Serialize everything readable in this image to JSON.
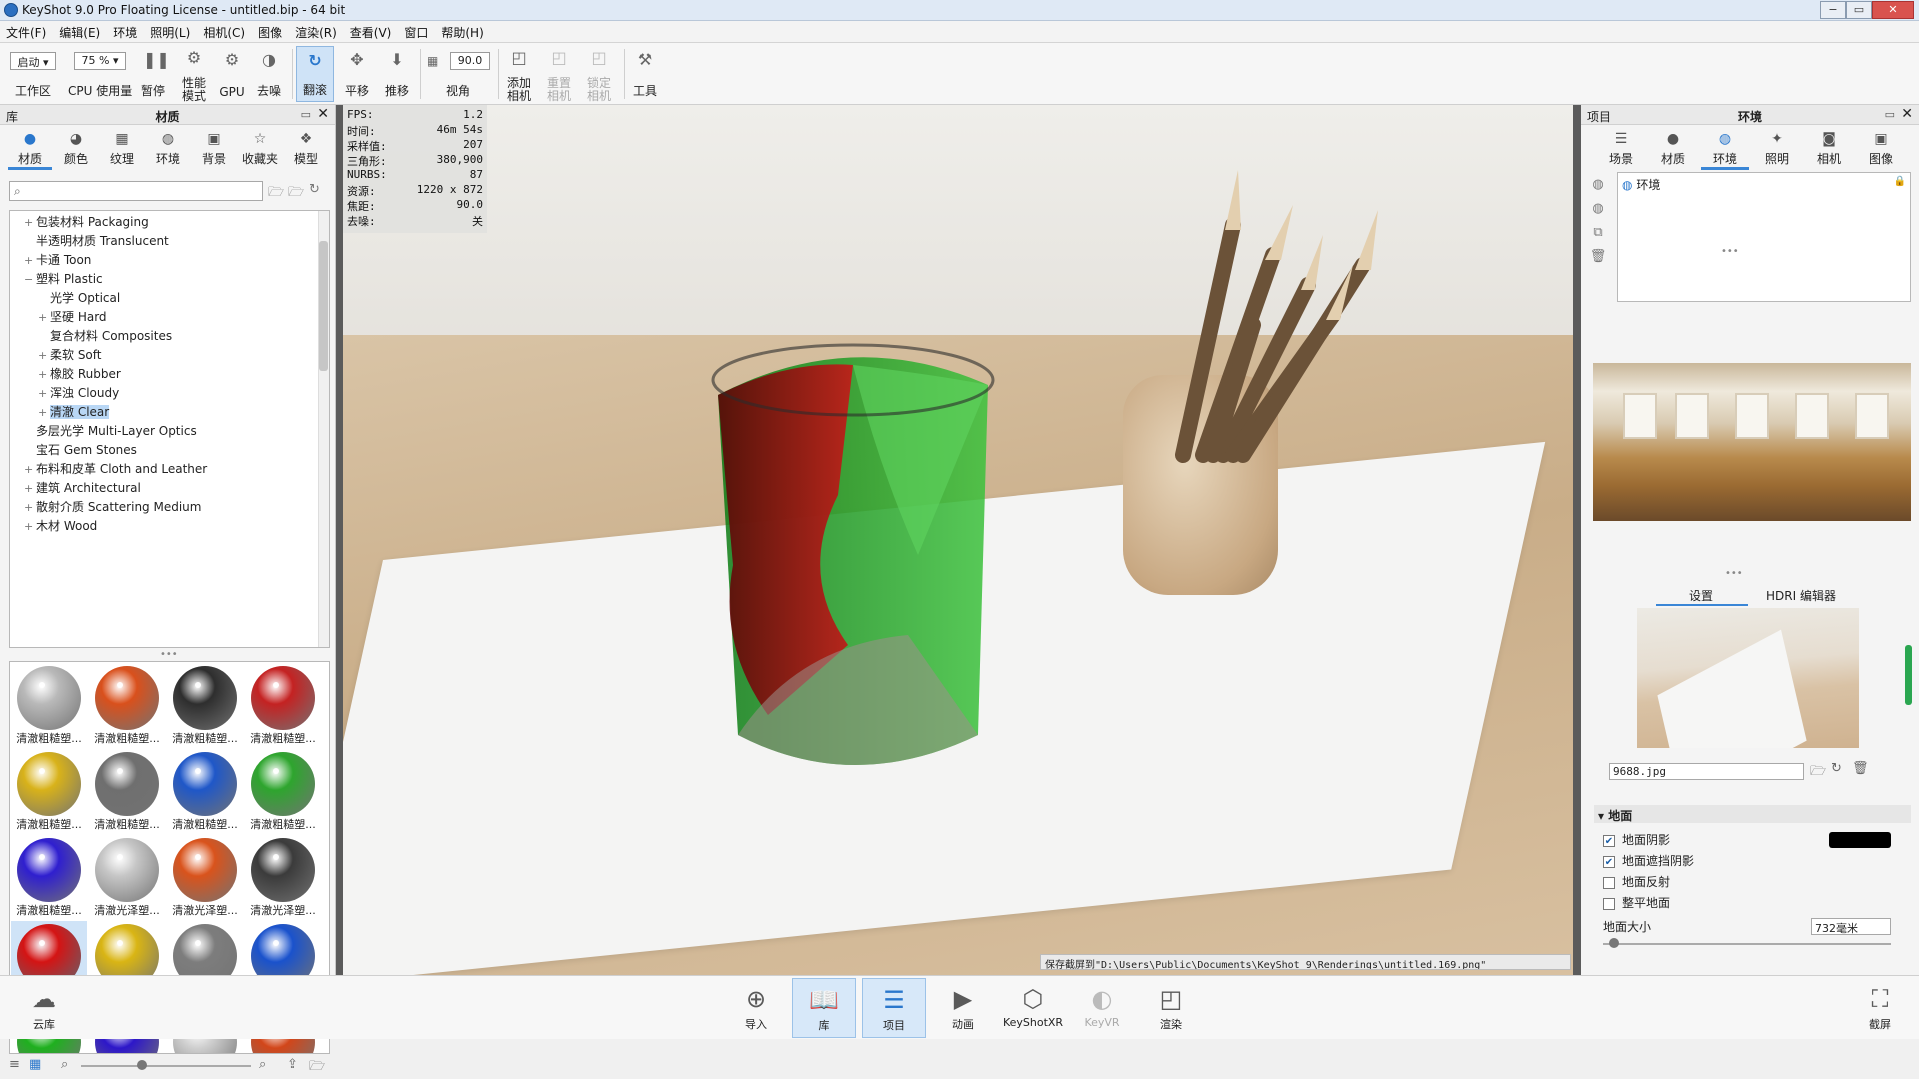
{
  "window": {
    "title": "KeyShot 9.0 Pro Floating License  - untitled.bip  - 64 bit"
  },
  "menu": [
    "文件(F)",
    "编辑(E)",
    "环境",
    "照明(L)",
    "相机(C)",
    "图像",
    "渲染(R)",
    "查看(V)",
    "窗口",
    "帮助(H)"
  ],
  "toolbar": {
    "workspace_value": "启动",
    "workspace_label": "工作区",
    "cpu_value": "75 %",
    "cpu_label": "CPU 使用量",
    "pause_label": "暂停",
    "perf_label": "性能\n模式",
    "gpu_label": "GPU",
    "denoise_label": "去噪",
    "tumble_label": "翻滚",
    "pan_label": "平移",
    "dolly_label": "推移",
    "fov_value": "90.0",
    "fov_label": "视角",
    "add_camera_label": "添加\n相机",
    "reset_camera_label": "重置\n相机",
    "lock_camera_label": "锁定\n相机",
    "tools_label": "工具"
  },
  "library": {
    "header_left": "库",
    "header_title": "材质",
    "tabs": [
      "材质",
      "颜色",
      "纹理",
      "环境",
      "背景",
      "收藏夹",
      "模型"
    ],
    "selected_tab": "材质",
    "search_placeholder": "",
    "tree": [
      {
        "label": "包装材料 Packaging",
        "level": 0,
        "exp": "+"
      },
      {
        "label": "半透明材质 Translucent",
        "level": 0,
        "exp": ""
      },
      {
        "label": "卡通 Toon",
        "level": 0,
        "exp": "+"
      },
      {
        "label": "塑料 Plastic",
        "level": 0,
        "exp": "−"
      },
      {
        "label": "光学 Optical",
        "level": 1,
        "exp": ""
      },
      {
        "label": "坚硬 Hard",
        "level": 1,
        "exp": "+"
      },
      {
        "label": "复合材料 Composites",
        "level": 1,
        "exp": ""
      },
      {
        "label": "柔软 Soft",
        "level": 1,
        "exp": "+"
      },
      {
        "label": "橡胶 Rubber",
        "level": 1,
        "exp": "+"
      },
      {
        "label": "浑浊 Cloudy",
        "level": 1,
        "exp": "+"
      },
      {
        "label": "清澈 Clear",
        "level": 1,
        "exp": "+",
        "selected": true
      },
      {
        "label": "多层光学 Multi-Layer Optics",
        "level": 0,
        "exp": ""
      },
      {
        "label": "宝石 Gem Stones",
        "level": 0,
        "exp": ""
      },
      {
        "label": "布料和皮革 Cloth and Leather",
        "level": 0,
        "exp": "+"
      },
      {
        "label": "建筑 Architectural",
        "level": 0,
        "exp": "+"
      },
      {
        "label": "散射介质 Scattering Medium",
        "level": 0,
        "exp": "+"
      },
      {
        "label": "木材 Wood",
        "level": 0,
        "exp": "+"
      }
    ],
    "materials": [
      {
        "label": "清澈粗糙塑...",
        "color": "#b9b9b9"
      },
      {
        "label": "清澈粗糙塑...",
        "color": "#d9501c"
      },
      {
        "label": "清澈粗糙塑...",
        "color": "#2e2e2e"
      },
      {
        "label": "清澈粗糙塑...",
        "color": "#c42222"
      },
      {
        "label": "清澈粗糙塑...",
        "color": "#d8b21a"
      },
      {
        "label": "清澈粗糙塑...",
        "color": "#6f6f6f"
      },
      {
        "label": "清澈粗糙塑...",
        "color": "#1f57c8"
      },
      {
        "label": "清澈粗糙塑...",
        "color": "#2ea52e"
      },
      {
        "label": "清澈粗糙塑...",
        "color": "#2f1fcf"
      },
      {
        "label": "清澈光泽塑...",
        "color": "#c6c6c6"
      },
      {
        "label": "清澈光泽塑...",
        "color": "#d9531c"
      },
      {
        "label": "清澈光泽塑...",
        "color": "#3b3b3b"
      },
      {
        "label": "清澈光泽塑...",
        "color": "#d41414",
        "selected": true
      },
      {
        "label": "清澈光泽塑...",
        "color": "#d9b514"
      },
      {
        "label": "清澈光泽塑...",
        "color": "#7d7d7d"
      },
      {
        "label": "清澈光泽塑...",
        "color": "#1a52cc"
      },
      {
        "label": "",
        "color": "#1fb01f"
      },
      {
        "label": "",
        "color": "#2d17c9"
      },
      {
        "label": "",
        "color": "#cfcfcf"
      },
      {
        "label": "",
        "color": "#d2461a"
      }
    ]
  },
  "viewport": {
    "stats": [
      {
        "k": "FPS:",
        "v": "1.2"
      },
      {
        "k": "时间:",
        "v": "46m 54s"
      },
      {
        "k": "采样值:",
        "v": "207"
      },
      {
        "k": "三角形:",
        "v": "380,900"
      },
      {
        "k": "NURBS:",
        "v": "87"
      },
      {
        "k": "资源:",
        "v": "1220 x 872"
      },
      {
        "k": "焦距:",
        "v": "90.0"
      },
      {
        "k": "去噪:",
        "v": "关"
      }
    ],
    "save_message": "保存截屏到\"D:\\Users\\Public\\Documents\\KeyShot 9\\Renderings\\untitled.169.png\""
  },
  "project": {
    "header_left": "项目",
    "header_title": "环境",
    "tabs": [
      "场景",
      "材质",
      "环境",
      "照明",
      "相机",
      "图像"
    ],
    "selected_tab": "环境",
    "env_item": "环境",
    "subtabs": [
      "设置",
      "HDRI 编辑器"
    ],
    "file": "9688.jpg",
    "ground_section": "地面",
    "ground_shadows": "地面阴影",
    "ground_occlusion": "地面遮挡阴影",
    "ground_reflections": "地面反射",
    "flatten_ground": "整平地面",
    "ground_size_label": "地面大小",
    "ground_size_value": "732毫米",
    "ground_shadows_checked": true,
    "ground_occlusion_checked": true,
    "ground_reflections_checked": false,
    "flatten_ground_checked": false
  },
  "bottom": {
    "cloud_label": "云库",
    "buttons": [
      {
        "label": "导入",
        "icon": "import-icon"
      },
      {
        "label": "库",
        "icon": "library-icon",
        "selected": true
      },
      {
        "label": "项目",
        "icon": "project-icon",
        "selected": true
      },
      {
        "label": "动画",
        "icon": "animation-icon"
      },
      {
        "label": "KeyShotXR",
        "icon": "keyshotxr-icon"
      },
      {
        "label": "KeyVR",
        "icon": "keyvr-icon"
      },
      {
        "label": "渲染",
        "icon": "render-icon"
      }
    ],
    "screenshot_label": "截屏"
  }
}
